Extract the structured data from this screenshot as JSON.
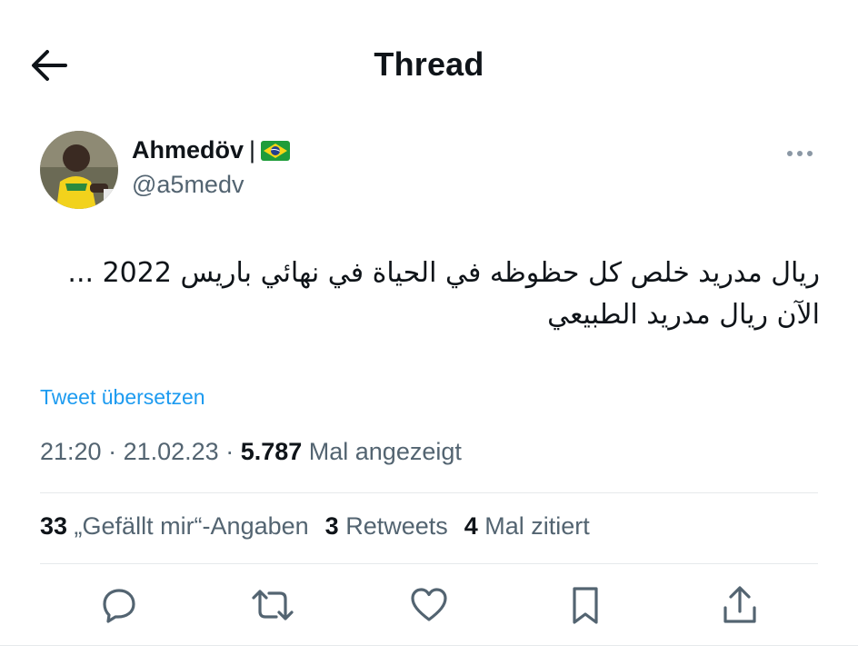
{
  "header": {
    "title": "Thread",
    "back_icon": "arrow-left-icon"
  },
  "author": {
    "name": "Ahmedöv",
    "separator": "|",
    "flag_icon": "brazil-flag-icon",
    "handle": "@a5medv"
  },
  "tweet": {
    "lines": [
      "ريال مدريد خلص كل حظوظه في الحياة  في نهائي باريس 2022 ...",
      "الآن ريال مدريد الطبيعي"
    ],
    "translate_label": "Tweet übersetzen"
  },
  "meta": {
    "time": "21:20",
    "sep1": " · ",
    "date": "21.02.23",
    "sep2": " · ",
    "views_count": "5.787",
    "views_label": " Mal angezeigt"
  },
  "stats": {
    "likes_count": "33",
    "likes_label": " „Gefällt mir“-Angaben",
    "retweets_count": "3",
    "retweets_label": " Retweets",
    "quotes_count": "4",
    "quotes_label": " Mal zitiert"
  },
  "actions": [
    "reply-icon",
    "retweet-icon",
    "like-icon",
    "bookmark-icon",
    "share-icon"
  ],
  "colors": {
    "link": "#1d9bf0",
    "secondary": "#536471",
    "text": "#0f1419"
  }
}
